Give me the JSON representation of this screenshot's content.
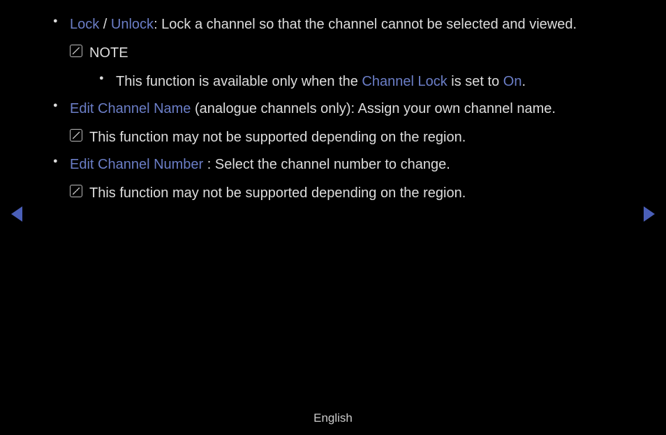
{
  "items": [
    {
      "lock_label": "Lock",
      "separator": " / ",
      "unlock_label": "Unlock",
      "desc": ": Lock a channel so that the channel cannot be selected and viewed.",
      "note_label": "NOTE",
      "sub": {
        "pre": "This function is available only when the ",
        "channel_lock": "Channel Lock",
        "mid": " is set to ",
        "on": "On",
        "post": "."
      }
    },
    {
      "title": "Edit Channel Name",
      "desc": " (analogue channels only): Assign your own channel name.",
      "note": "This function may not be supported depending on the region."
    },
    {
      "title": "Edit Channel Number",
      "desc": " : Select the channel number to change.",
      "note": "This function may not be supported depending on the region."
    }
  ],
  "footer": "English"
}
